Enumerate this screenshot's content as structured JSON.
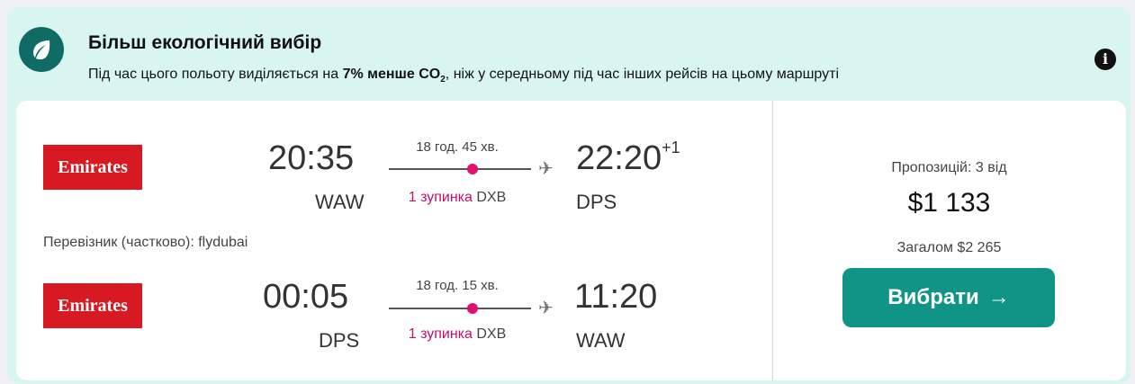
{
  "eco": {
    "title": "Більш екологічний вибір",
    "desc_before": "Під час цього польоту виділяється на ",
    "desc_bold": "7% менше CO",
    "desc_sub": "2",
    "desc_after": ", ніж у середньому під час інших рейсів на цьому маршруті",
    "info_label": "i",
    "accent": "#0f6b63"
  },
  "outbound": {
    "airline": "Emirates",
    "depart_time": "20:35",
    "depart_code": "WAW",
    "duration": "18 год. 45 хв.",
    "stops_count": "1 зупинка",
    "stops_via": "DXB",
    "arrive_time": "22:20",
    "arrive_day_offset": "+1",
    "arrive_code": "DPS"
  },
  "operator_note": "Перевізник (частково): flydubai",
  "inbound": {
    "airline": "Emirates",
    "depart_time": "00:05",
    "depart_code": "DPS",
    "duration": "18 год. 15 хв.",
    "stops_count": "1 зупинка",
    "stops_via": "DXB",
    "arrive_time": "11:20",
    "arrive_code": "WAW"
  },
  "pricing": {
    "offers": "Пропозицій: 3 від",
    "price": "$1 133",
    "total": "Загалом $2 265",
    "select_label": "Вибрати",
    "button_color": "#109486",
    "stop_color": "#e0116d"
  }
}
